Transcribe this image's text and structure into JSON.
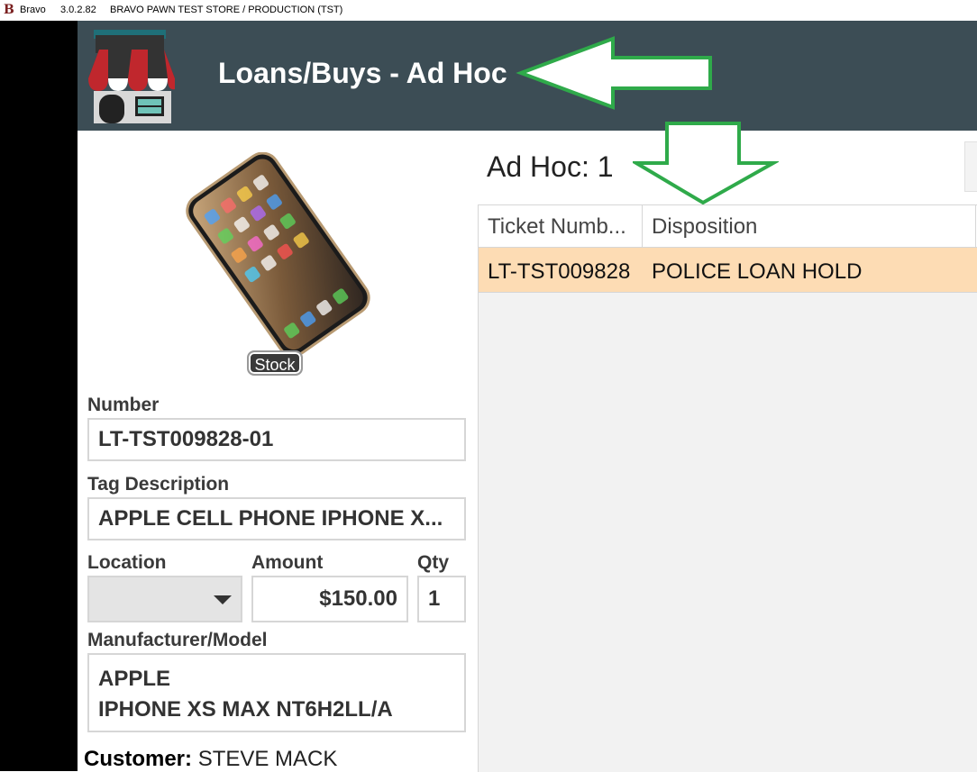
{
  "window": {
    "app_name": "Bravo",
    "version": "3.0.2.82",
    "store": "BRAVO PAWN TEST STORE / PRODUCTION (TST)"
  },
  "header": {
    "title": "Loans/Buys - Ad Hoc"
  },
  "item": {
    "stock_label": "Stock",
    "number_label": "Number",
    "number": "LT-TST009828-01",
    "tag_label": "Tag Description",
    "tag": "APPLE CELL PHONE IPHONE X...",
    "location_label": "Location",
    "location": "",
    "amount_label": "Amount",
    "amount": "$150.00",
    "qty_label": "Qty",
    "qty": "1",
    "mfr_label": "Manufacturer/Model",
    "mfr_line1": "APPLE",
    "mfr_line2": "IPHONE XS MAX NT6H2LL/A",
    "customer_label": "Customer:",
    "customer": "STEVE MACK"
  },
  "adhoc": {
    "title": "Ad Hoc: 1",
    "columns": [
      "Ticket Numb...",
      "Disposition"
    ],
    "rows": [
      {
        "ticket": "LT-TST009828",
        "disposition": "POLICE LOAN HOLD"
      }
    ]
  },
  "colors": {
    "header_bg": "#3c4d55",
    "row_highlight": "#fddcb4",
    "annotation_arrow": "#2faa4a"
  },
  "icons": [
    "store-icon",
    "phone-photo",
    "dropdown-caret-icon",
    "annotation-arrow-left",
    "annotation-arrow-down"
  ]
}
